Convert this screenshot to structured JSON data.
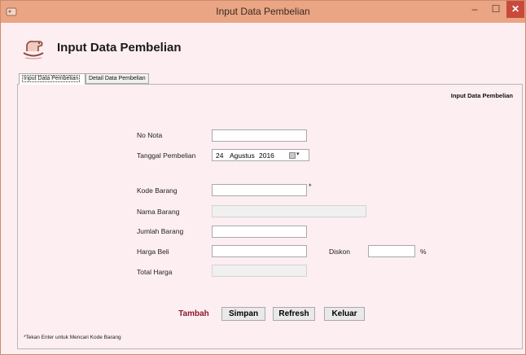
{
  "window": {
    "title": "Input Data Pembelian",
    "minimize_glyph": "–",
    "maximize_glyph": "☐",
    "close_glyph": "✕"
  },
  "header": {
    "heading": "Input Data Pembelian",
    "logo_icon": "baby-rocking-horse-logo"
  },
  "tabs": [
    {
      "label": "Input Data Pembelian",
      "active": true
    },
    {
      "label": "Detail Data Pembelian",
      "active": false
    }
  ],
  "panel": {
    "title": "Input Data Pembelian"
  },
  "form": {
    "no_nota": {
      "label": "No Nota",
      "value": ""
    },
    "tanggal_pembelian": {
      "label": "Tanggal Pembelian",
      "day": "24",
      "month": "Agustus",
      "year": "2016"
    },
    "kode_barang": {
      "label": "Kode Barang",
      "value": "",
      "required_mark": "*"
    },
    "nama_barang": {
      "label": "Nama Barang",
      "value": ""
    },
    "jumlah_barang": {
      "label": "Jumlah Barang",
      "value": ""
    },
    "harga_beli": {
      "label": "Harga Beli",
      "value": ""
    },
    "diskon": {
      "label": "Diskon",
      "value": "",
      "unit": "%"
    },
    "total_harga": {
      "label": "Total Harga",
      "value": ""
    }
  },
  "buttons": {
    "tambah": "Tambah",
    "simpan": "Simpan",
    "refresh": "Refresh",
    "keluar": "Keluar"
  },
  "note": "*Tekan Enter untuk Mencari Kode Barang",
  "colors": {
    "titlebar": "#e9a584",
    "window_bg": "#fdeef2",
    "close_button": "#c74a3d",
    "tambah_text": "#8b1a2b"
  }
}
